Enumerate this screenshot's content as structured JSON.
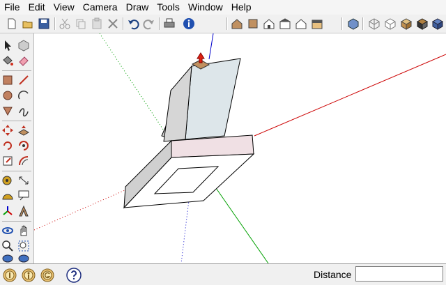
{
  "menu": [
    "File",
    "Edit",
    "View",
    "Camera",
    "Draw",
    "Tools",
    "Window",
    "Help"
  ],
  "toolbar_icons": [
    "new-icon",
    "open-icon",
    "save-icon",
    "cut-icon",
    "copy-icon",
    "paste-icon",
    "erase-icon",
    "undo-icon",
    "redo-icon",
    "print-icon",
    "model-info-icon",
    "iso-view-icon",
    "top-view-icon",
    "front-view-icon",
    "right-view-icon",
    "back-view-icon",
    "left-view-icon",
    "xray-icon",
    "wireframe-icon",
    "hidden-line-icon",
    "shaded-icon",
    "shaded-textures-icon",
    "monochrome-icon"
  ],
  "palette_icons": [
    "select-icon",
    "make-component-icon",
    "paint-bucket-icon",
    "eraser-icon",
    "rectangle-icon",
    "line-icon",
    "circle-icon",
    "arc-icon",
    "polygon-icon",
    "freehand-icon",
    "move-icon",
    "push-pull-icon",
    "rotate-icon",
    "follow-me-icon",
    "scale-icon",
    "offset-icon",
    "tape-measure-icon",
    "dimension-icon",
    "protractor-icon",
    "text-icon",
    "axes-icon",
    "3d-text-icon",
    "orbit-icon",
    "pan-icon",
    "zoom-icon",
    "zoom-window-icon",
    "zoom-extents-icon",
    "previous-view-icon"
  ],
  "status": {
    "distance_label": "Distance",
    "distance_value": ""
  },
  "colors": {
    "red_axis": "#cc0000",
    "green_axis": "#00a000",
    "blue_axis": "#0000cc",
    "face_front": "#e8e8e8",
    "face_side": "#d0d0d0",
    "face_back": "#dde6ea",
    "face_top": "#f0e0e4"
  }
}
